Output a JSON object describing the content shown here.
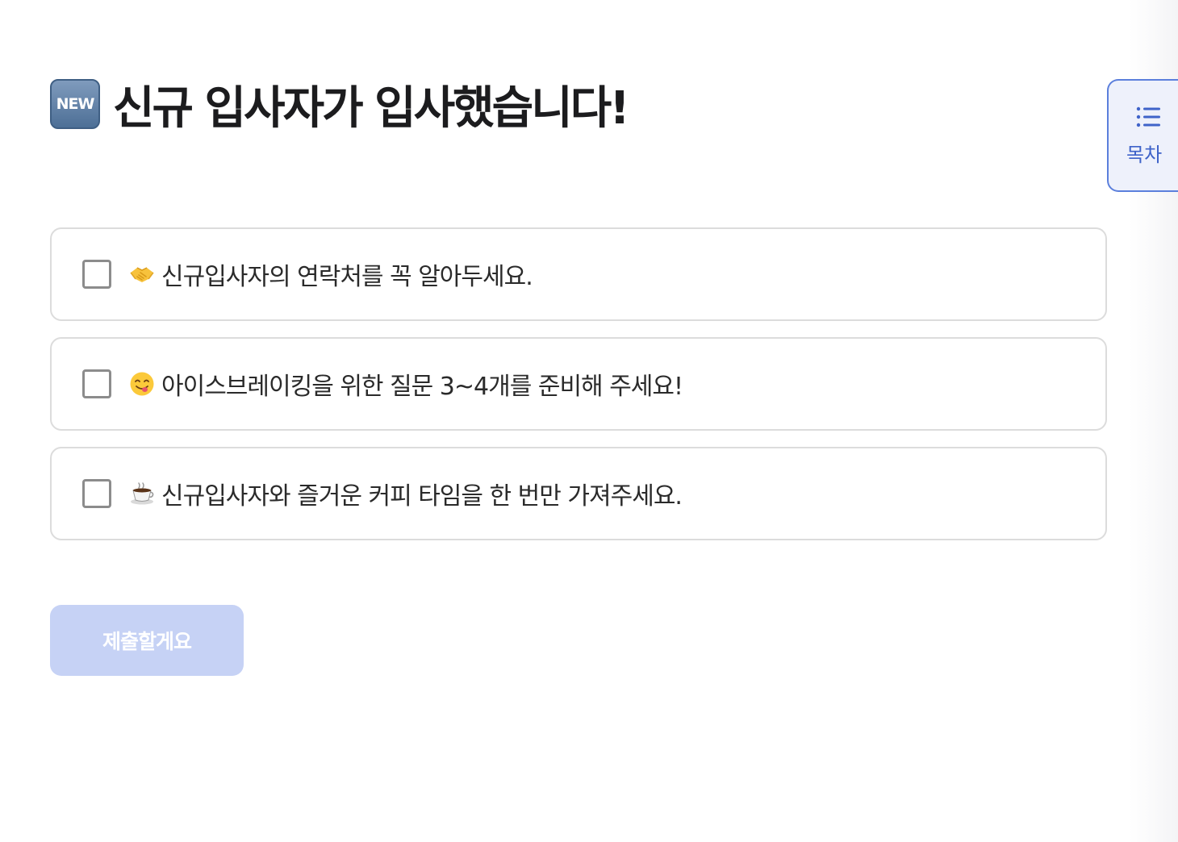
{
  "header": {
    "badge_label": "NEW",
    "title": "신규 입사자가 입사했습니다!"
  },
  "toc": {
    "label": "목차",
    "icon": "list-icon"
  },
  "checklist": {
    "items": [
      {
        "icon": "handshake-icon",
        "text": "신규입사자의 연락처를 꼭 알아두세요.",
        "checked": false
      },
      {
        "icon": "yum-face-icon",
        "text": "아이스브레이킹을 위한 질문 3~4개를 준비해 주세요!",
        "checked": false
      },
      {
        "icon": "coffee-icon",
        "text": "신규입사자와 즐거운 커피 타임을 한 번만 가져주세요.",
        "checked": false
      }
    ]
  },
  "submit": {
    "label": "제출할게요",
    "enabled": false
  },
  "colors": {
    "accent": "#5b7fdc",
    "submit_disabled_bg": "#c6d2f5",
    "border": "#dcdcdc"
  }
}
